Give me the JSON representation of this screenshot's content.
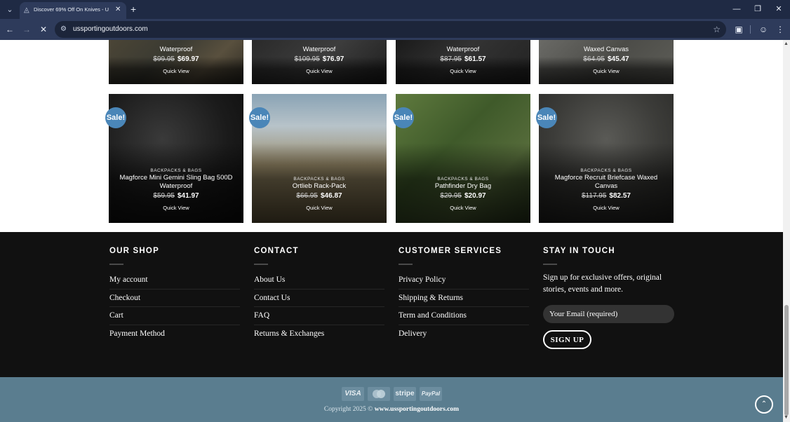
{
  "browser": {
    "tab_title": "Discover 69% Off On Knives - U",
    "url": "ussportingoutdoors.com",
    "icons": {
      "tab_menu": "chevron-down-icon",
      "favicon": "site-favicon-icon",
      "tab_close": "close-icon",
      "new_tab": "plus-icon",
      "back": "arrow-left-icon",
      "forward": "arrow-right-icon",
      "stop": "close-icon",
      "site_info": "tune-icon",
      "bookmark": "star-icon",
      "extensions": "puzzle-icon",
      "profile": "profile-icon",
      "menu": "more-vertical-icon",
      "minimize": "minimize-icon",
      "restore": "restore-icon",
      "close_window": "close-icon"
    }
  },
  "products_top": [
    {
      "name": "Waterproof",
      "old_price": "$99.95",
      "new_price": "$69.97",
      "quick_view": "Quick View"
    },
    {
      "name": "Waterproof",
      "old_price": "$109.95",
      "new_price": "$76.97",
      "quick_view": "Quick View"
    },
    {
      "name": "Waterproof",
      "old_price": "$87.95",
      "new_price": "$61.57",
      "quick_view": "Quick View"
    },
    {
      "name": "Waxed Canvas",
      "old_price": "$64.95",
      "new_price": "$45.47",
      "quick_view": "Quick View"
    }
  ],
  "products": [
    {
      "badge": "Sale!",
      "category": "BACKPACKS & BAGS",
      "name": "Magforce Mini Gemini Sling Bag 500D Waterproof",
      "old_price": "$59.95",
      "new_price": "$41.97",
      "quick_view": "Quick View"
    },
    {
      "badge": "Sale!",
      "category": "BACKPACKS & BAGS",
      "name": "Ortlieb Rack-Pack",
      "old_price": "$66.95",
      "new_price": "$46.87",
      "quick_view": "Quick View"
    },
    {
      "badge": "Sale!",
      "category": "BACKPACKS & BAGS",
      "name": "Pathfinder Dry Bag",
      "old_price": "$29.95",
      "new_price": "$20.97",
      "quick_view": "Quick View"
    },
    {
      "badge": "Sale!",
      "category": "BACKPACKS & BAGS",
      "name": "Magforce Recruit Briefcase Waxed Canvas",
      "old_price": "$117.95",
      "new_price": "$82.57",
      "quick_view": "Quick View"
    }
  ],
  "footer": {
    "shop": {
      "title": "OUR SHOP",
      "links": [
        "My account",
        "Checkout",
        "Cart",
        "Payment Method"
      ]
    },
    "contact": {
      "title": "CONTACT",
      "links": [
        "About Us",
        "Contact Us",
        "FAQ",
        "Returns & Exchanges"
      ]
    },
    "services": {
      "title": "CUSTOMER SERVICES",
      "links": [
        "Privacy Policy",
        "Shipping & Returns",
        "Term and Conditions",
        "Delivery"
      ]
    },
    "stay": {
      "title": "STAY IN TOUCH",
      "text": "Sign up for exclusive offers, original stories, events and more.",
      "email_placeholder": "Your Email (required)",
      "signup_label": "SIGN UP"
    },
    "payment_methods": [
      "VISA",
      "MasterCard",
      "stripe",
      "PayPal"
    ],
    "copyright_prefix": "Copyright 2025 © ",
    "copyright_site": "www.ussportingoutdoors.com",
    "back_to_top_icon": "chevron-up-icon"
  },
  "colors": {
    "sale_badge": "#4a86b8",
    "footer_bg": "#111111",
    "absolute_footer_bg": "#5a7d8f",
    "browser_chrome": "#2e3b5b"
  }
}
